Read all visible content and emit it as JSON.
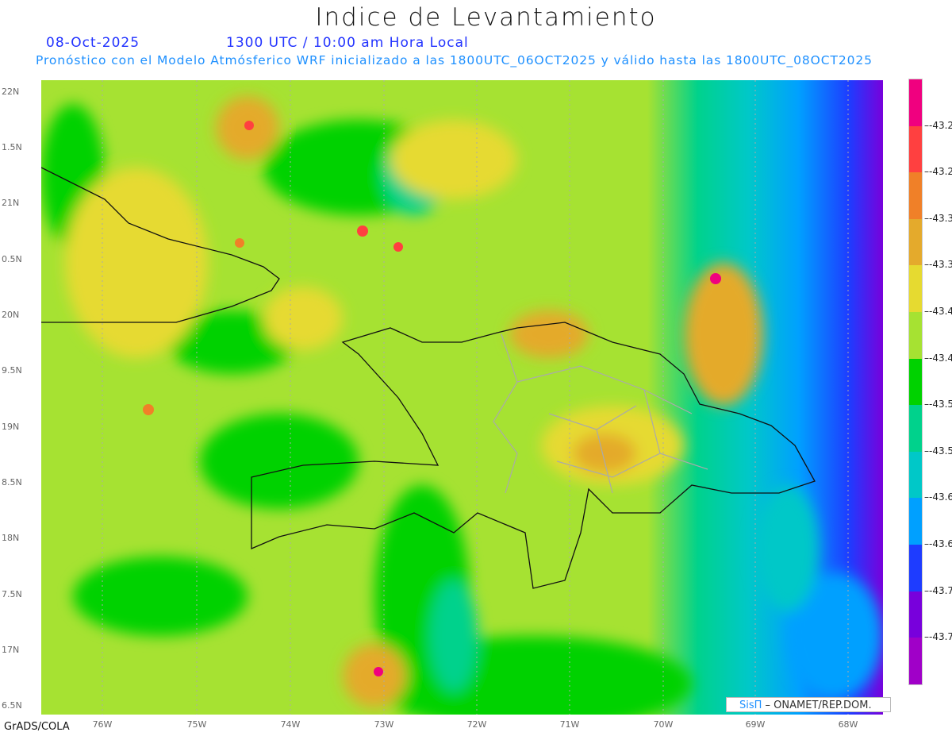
{
  "header": {
    "title": "Indice de Levantamiento",
    "date": "08-Oct-2025",
    "time": "1300 UTC / 10:00 am Hora Local",
    "subtitle": "Pronóstico con el Modelo Atmósferico WRF inicializado a las 1800UTC_06OCT2025 y válido hasta las  1800UTC_08OCT2025"
  },
  "axes": {
    "lat_labels": [
      "22N",
      "1.5N",
      "21N",
      "0.5N",
      "20N",
      "9.5N",
      "19N",
      "8.5N",
      "18N",
      "7.5N",
      "17N",
      "6.5N"
    ],
    "lon_labels": [
      "76W",
      "75W",
      "74W",
      "73W",
      "72W",
      "71W",
      "70W",
      "69W",
      "68W"
    ]
  },
  "colorbar": {
    "colors": [
      "#f0007f",
      "#ff4040",
      "#f08028",
      "#e4aa2c",
      "#e6da30",
      "#a6e232",
      "#00d200",
      "#00d28c",
      "#00c8c8",
      "#00a0ff",
      "#1e3cff",
      "#7800dc",
      "#a000c8"
    ],
    "labels": [
      "-43.2",
      "-43.2",
      "-43.3",
      "-43.3",
      "-43.4",
      "-43.4",
      "-43.5",
      "-43.5",
      "-43.6",
      "-43.6",
      "-43.7",
      "-43.7"
    ]
  },
  "footer": {
    "grads": "GrADS/COLA",
    "credit_logo": "SisΠ",
    "credit_text": " –  ONAMET/REP.DOM."
  }
}
